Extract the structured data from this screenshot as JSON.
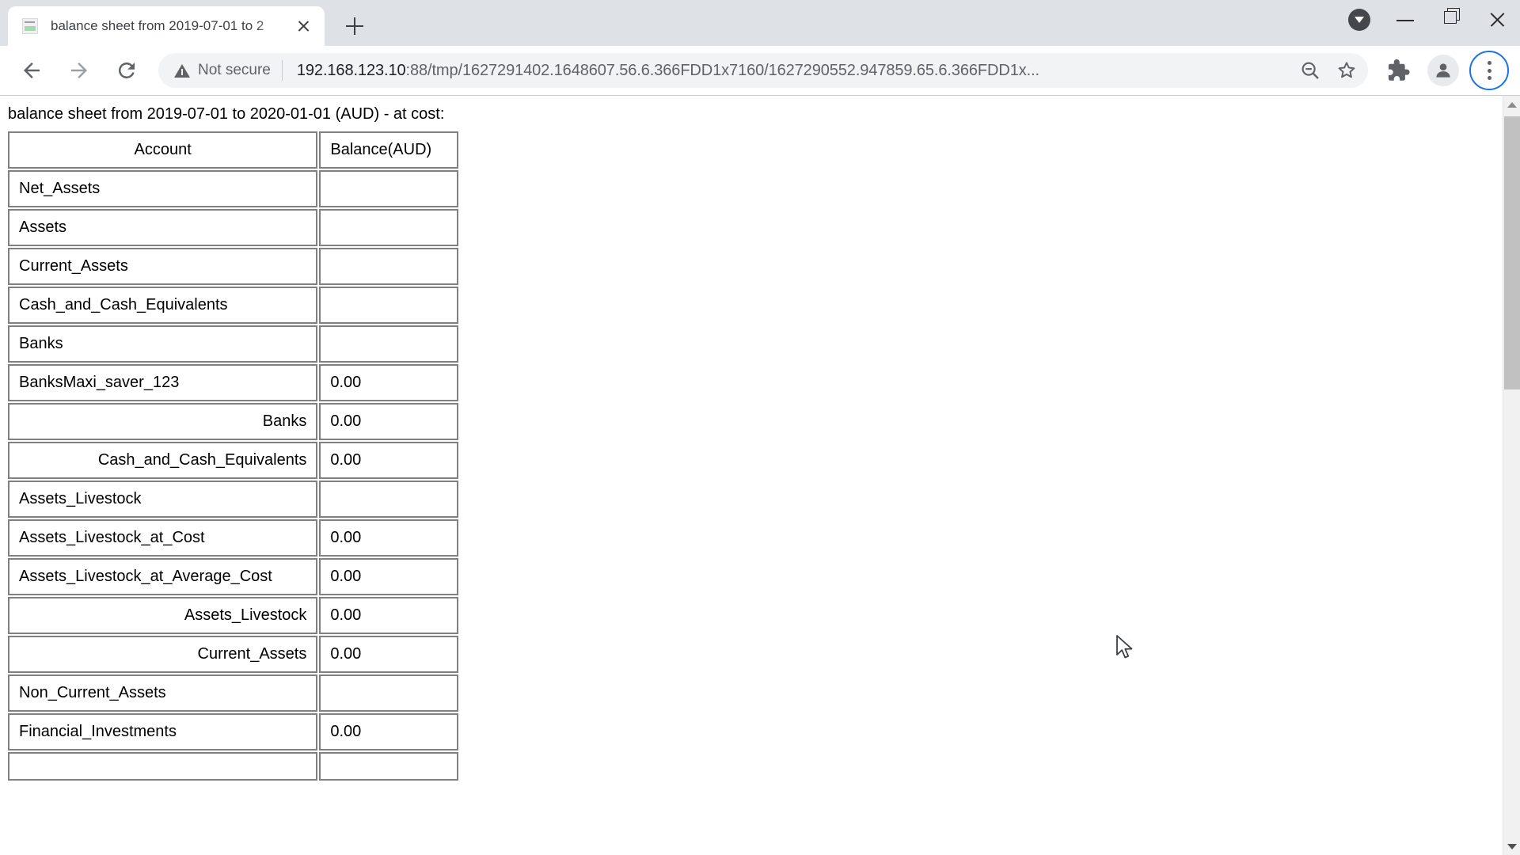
{
  "browser": {
    "tab": {
      "title": "balance sheet from 2019-07-01 to 2",
      "favicon": "spreadsheet-page-icon",
      "close_label": "×"
    },
    "new_tab_label": "+",
    "window_controls": {
      "download_indicator": "download-arrow",
      "minimize": "–",
      "restore": "restore",
      "close": "×"
    },
    "toolbar": {
      "back": "back-arrow",
      "forward": "forward-arrow",
      "reload": "reload-arrow",
      "security_label": "Not secure",
      "url": "192.168.123.10:88/tmp/1627291402.1648607.56.6.366FDD1x7160/1627290552.947859.65.6.366FDD1x...",
      "url_host": "192.168.123.10",
      "url_path": ":88/tmp/1627291402.1648607.56.6.366FDD1x7160/1627290552.947859.65.6.366FDD1x...",
      "zoom_out_icon": "zoom-out-icon",
      "bookmark_icon": "star-icon",
      "extensions_icon": "puzzle-icon",
      "profile_icon": "avatar-icon",
      "menu_icon": "three-dots-icon"
    },
    "accent_color": "#1a73e8"
  },
  "page": {
    "heading": "balance sheet from 2019-07-01 to 2020-01-01 (AUD) - at cost:",
    "table": {
      "columns": [
        "Account",
        "Balance(AUD)"
      ],
      "rows": [
        {
          "account": "Net_Assets",
          "balance": "",
          "style": "group"
        },
        {
          "account": "Assets",
          "balance": "",
          "style": "group"
        },
        {
          "account": "Current_Assets",
          "balance": "",
          "style": "group"
        },
        {
          "account": "Cash_and_Cash_Equivalents",
          "balance": "",
          "style": "group"
        },
        {
          "account": "Banks",
          "balance": "",
          "style": "group"
        },
        {
          "account": "BanksMaxi_saver_123",
          "balance": "0.00",
          "style": "leaf"
        },
        {
          "account": "Banks",
          "balance": "0.00",
          "style": "total"
        },
        {
          "account": "Cash_and_Cash_Equivalents",
          "balance": "0.00",
          "style": "total"
        },
        {
          "account": "Assets_Livestock",
          "balance": "",
          "style": "group"
        },
        {
          "account": "Assets_Livestock_at_Cost",
          "balance": "0.00",
          "style": "leaf"
        },
        {
          "account": "Assets_Livestock_at_Average_Cost",
          "balance": "0.00",
          "style": "leaf"
        },
        {
          "account": "Assets_Livestock",
          "balance": "0.00",
          "style": "total"
        },
        {
          "account": "Current_Assets",
          "balance": "0.00",
          "style": "total"
        },
        {
          "account": "Non_Current_Assets",
          "balance": "",
          "style": "group"
        },
        {
          "account": "Financial_Investments",
          "balance": "0.00",
          "style": "leaf"
        },
        {
          "account": "",
          "balance": "",
          "style": "leaf"
        }
      ]
    }
  },
  "scrollbar": {
    "orientation": "vertical",
    "up_arrow": "scroll-up-arrow",
    "down_arrow": "scroll-down-arrow"
  }
}
